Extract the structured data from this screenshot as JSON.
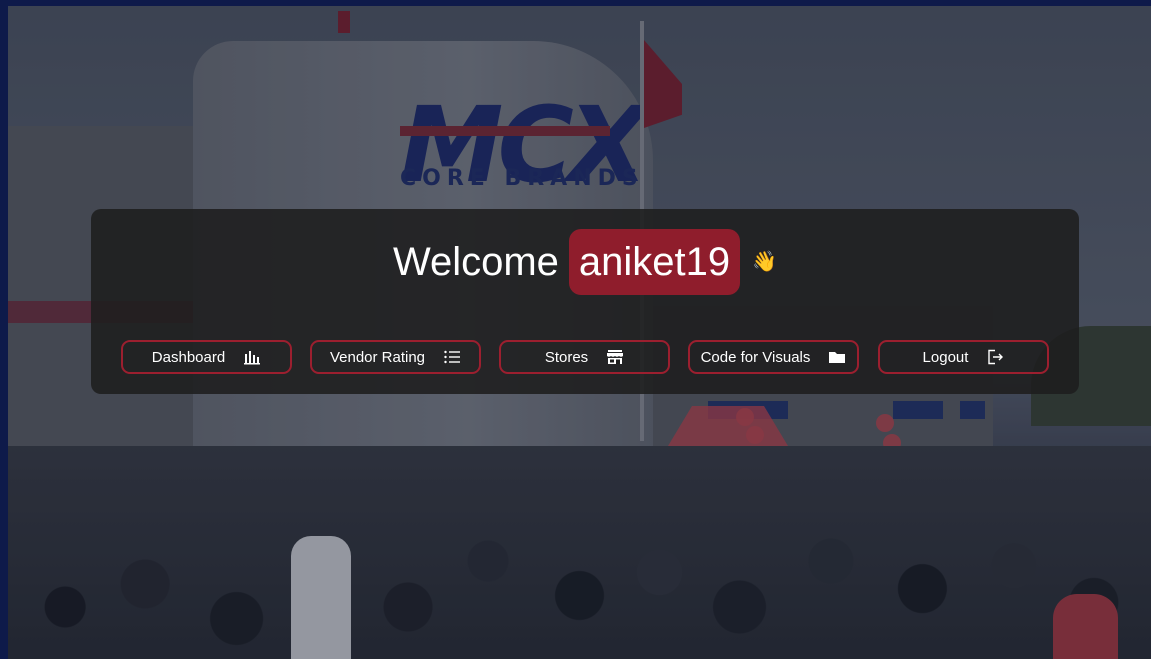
{
  "welcome": {
    "greeting": "Welcome",
    "username": "aniket19",
    "wave_emoji": "👋"
  },
  "nav": {
    "items": [
      {
        "label": "Dashboard",
        "icon": "bar-chart-icon"
      },
      {
        "label": "Vendor Rating",
        "icon": "list-icon"
      },
      {
        "label": "Stores",
        "icon": "store-icon"
      },
      {
        "label": "Code for Visuals",
        "icon": "folder-icon"
      },
      {
        "label": "Logout",
        "icon": "logout-icon"
      }
    ]
  },
  "background": {
    "logo_text": "MCX",
    "logo_subtext": "CORE BRANDS"
  },
  "colors": {
    "accent": "#9c1f2f",
    "username_bg": "#8f1d2c",
    "panel_bg": "#1e1e1e",
    "frame": "#0e1a4a"
  }
}
